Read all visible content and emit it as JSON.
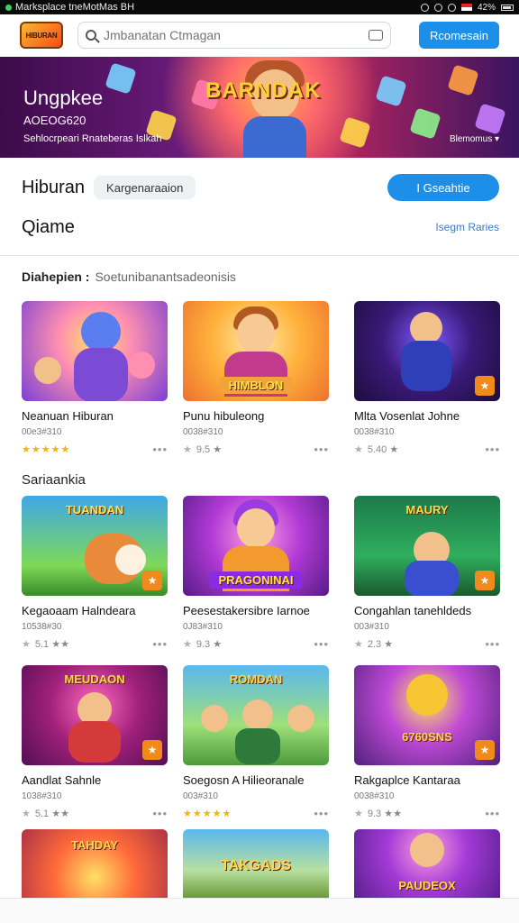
{
  "status_bar": {
    "title": "Marksplace tneMotMas BH",
    "right_text": "42%"
  },
  "header": {
    "logo_text": "HIBURAN",
    "search_placeholder": "Jmbanatan Ctmagan",
    "action_button": "Rcomesain"
  },
  "banner": {
    "title": "BARNDAK",
    "line1": "Ungpkee",
    "line2": "AOEOG620",
    "line3": "Sehlocrpeari Rnateberas Islkah",
    "line4": "Blemomus ▾"
  },
  "section1": {
    "title": "Hiburan",
    "chip": "Kargenaraaion",
    "button": "I Gseahtie"
  },
  "section2": {
    "title": "Qiame",
    "link": "Isegm Raries"
  },
  "filter": {
    "label": "Diahepien :",
    "value": "Soetunibanantsadeonisis"
  },
  "category_label": "Sariaankia",
  "cards_row1": [
    {
      "title": "Neanuan Hiburan",
      "sub": "00e3#310",
      "rating": "★★★★★",
      "rating_text": "",
      "badge": "",
      "corner": ""
    },
    {
      "title": "Punu hibuleong",
      "sub": "0038#310",
      "rating": "★",
      "rating_text": "9.5 ★",
      "badge": "HIMBLON",
      "corner": ""
    },
    {
      "title": "Mlta Vosenlat Johne",
      "sub": "0038#310",
      "rating": "★",
      "rating_text": "5.40 ★",
      "badge": "",
      "corner": "★"
    }
  ],
  "cards_row2": [
    {
      "title": "Kegaoaam Halndeara",
      "sub": "10538#30",
      "rating": "★",
      "rating_text": "5.1 ★★",
      "badge": "TUANDAN",
      "corner": "★"
    },
    {
      "title": "Peesestakersibre Iarnoe",
      "sub": "0J83#310",
      "rating": "★",
      "rating_text": "9.3 ★",
      "badge": "PRAGONINAI",
      "corner": ""
    },
    {
      "title": "Congahlan tanehldeds",
      "sub": "003#310",
      "rating": "★",
      "rating_text": "2.3 ★",
      "badge": "MAURY",
      "corner": "★"
    }
  ],
  "cards_row3": [
    {
      "title": "Aandlat Sahnle",
      "sub": "1038#310",
      "rating": "★",
      "rating_text": "5.1 ★★",
      "badge": "MEUDAON",
      "corner": "★"
    },
    {
      "title": "Soegosn A Hilieoranale",
      "sub": "003#310",
      "rating": "★★★★★",
      "rating_text": "",
      "badge": "ROMDAN",
      "corner": ""
    },
    {
      "title": "Rakgaplce Kantaraa",
      "sub": "0038#310",
      "rating": "★",
      "rating_text": "9.3 ★★",
      "badge": "6760SNS",
      "corner": "★"
    }
  ],
  "cards_row4": [
    {
      "badge": "TAHDAY"
    },
    {
      "badge": "TAKGADS"
    },
    {
      "badge": "PAUDEOX"
    }
  ],
  "colors": {
    "accent": "#1d8fe8",
    "star": "#f4b400"
  }
}
